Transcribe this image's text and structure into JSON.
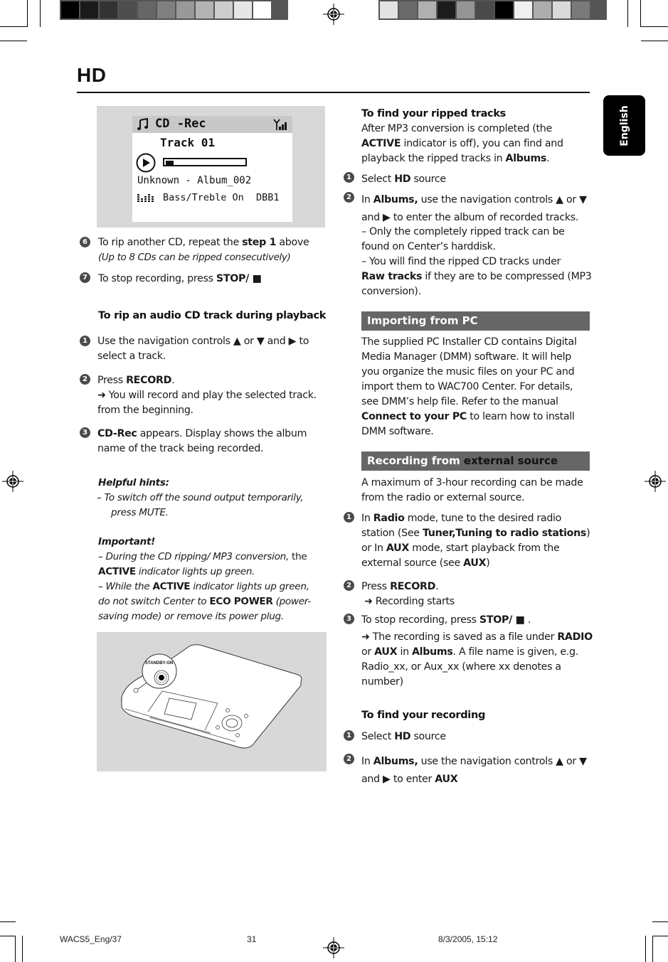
{
  "page": {
    "section_title": "HD",
    "language_tab": "English",
    "footer": {
      "file_ref": "WACS5_Eng/37",
      "page_number": "31",
      "date_time": "8/3/2005, 15:12"
    }
  },
  "calibration_bars": {
    "left": [
      "#000000",
      "#1a1a1a",
      "#333333",
      "#4d4d4d",
      "#666666",
      "#808080",
      "#999999",
      "#b3b3b3",
      "#cccccc",
      "#e6e6e6",
      "#ffffff"
    ],
    "right": [
      "#e3e3e3",
      "#6a6a6a",
      "#b0b0b0",
      "#1c1c1c",
      "#959595",
      "#4a4a4a",
      "#000000",
      "#f0f0f0",
      "#adadad",
      "#dadada",
      "#7a7a7a"
    ]
  },
  "lcd_display": {
    "mode": "CD -Rec",
    "track": "Track 01",
    "progress_fraction": 0.1,
    "album_line": "Unknown - Album_002",
    "eq_line": "Bass/Treble On",
    "dbb": "DBB1"
  },
  "device_illustration": {
    "button_label": "STANDBY-ON"
  },
  "left_column": {
    "steps_top": [
      {
        "number": "6",
        "text_pre": "To rip another CD, repeat the ",
        "bold": "step 1",
        "text_post": " above",
        "note": "(Up to 8 CDs can be ripped consecutively)"
      },
      {
        "number": "7",
        "text_pre": "To stop recording, press ",
        "bold": "STOP/ ■"
      }
    ],
    "playback_heading": "To rip an audio CD track during playback",
    "playback_steps": [
      {
        "number": "1",
        "line1": "Use the navigation controls ▲  or  ▼  and ▶ to",
        "line2": "select a track."
      },
      {
        "number": "2",
        "pre": "Press ",
        "bold": "RECORD",
        "post": ".",
        "result1": "➜ You will record and play the selected track.",
        "result2": "from the beginning."
      },
      {
        "number": "3",
        "bold": "CD-Rec",
        "post": " appears. Display shows the album",
        "line2": "name of the track being recorded."
      }
    ],
    "hints": {
      "heading": "Helpful hints:",
      "line1": "–  To switch off the sound output temporarily,",
      "line2": "press MUTE."
    },
    "important": {
      "heading": "Important!",
      "item1_pre": "–     During the CD ripping/ MP3 conversion,",
      "item1_post": " the",
      "item1_bold": "ACTIVE",
      "item1_rest": " indicator lights up green.",
      "item2_pre": "–   While the ",
      "item2_bold": "ACTIVE",
      "item2_post": " indicator lights up green,",
      "item2_line2_pre": "do not switch Center to ",
      "item2_line2_bold": "ECO POWER",
      "item2_line2_post": " (power-",
      "item2_line3": "saving mode) or remove its power plug."
    }
  },
  "right_column": {
    "find_ripped": {
      "heading": "To find your ripped tracks",
      "intro1": "After MP3 conversion is completed (the",
      "intro2_bold": "ACTIVE",
      "intro2_post": " indicator is off), you can find and",
      "intro3_pre": "playback the ripped tracks in ",
      "intro3_bold": "Albums",
      "intro3_post": ".",
      "steps": [
        {
          "number": "1",
          "pre": "Select ",
          "bold": "HD",
          "post": " source"
        },
        {
          "number": "2",
          "pre": "In ",
          "bold": "Albums,",
          "post": " use the navigation controls ▲  or  ▼",
          "line2": "and ▶ to enter the album of recorded tracks."
        }
      ],
      "note1a": "–  Only the completely ripped track can be",
      "note1b": "found on Center’s harddisk.",
      "note2a": "–   You will find the ripped CD tracks under",
      "note2b_bold": "Raw tracks",
      "note2b_post": " if they are to be compressed (MP3",
      "note2c": "conversion)."
    },
    "importing": {
      "bar_label": "Importing from PC",
      "lines": [
        "The supplied PC Installer CD contains Digital",
        "Media Manager (DMM) software.  It will help",
        "you organize the music files on your PC  and",
        "import them to WAC700 Center.  For details,",
        "see DMM’s help file. Refer to the manual"
      ],
      "line6_bold": "Connect to your PC",
      "line6_post": " to learn how to install",
      "line7": "DMM software."
    },
    "recording_external": {
      "bar_label_1": "Recording from ",
      "bar_label_2": "external source",
      "intro1": "A maximum of 3-hour recording can be made",
      "intro2": "from the radio or external source.",
      "step1": {
        "number": "1",
        "l1_pre": "In ",
        "l1_bold": "Radio",
        "l1_post": " mode, tune to the desired radio",
        "l2_pre": "station (See ",
        "l2_bold": "Tuner,Tuning to radio stations",
        "l2_post": ")",
        "l3_pre": "or In ",
        "l3_bold": "AUX",
        "l3_post": " mode, start playback from the",
        "l4_pre": "external source (see ",
        "l4_bold": "AUX",
        "l4_post": ")"
      },
      "step2": {
        "number": "2",
        "pre": "Press ",
        "bold": "RECORD",
        "post": ".",
        "result": "➜ Recording starts"
      },
      "step3": {
        "number": "3",
        "pre": "To stop recording,  press ",
        "bold": "STOP/ ■",
        "post": " .",
        "r1_pre": "➜ The recording is saved as a file under ",
        "r1_bold": "RADIO",
        "r2_pre": "or ",
        "r2_bold1": "AUX",
        "r2_mid": " in ",
        "r2_bold2": "Albums",
        "r2_post": ". A file name is given, e.g.",
        "r3": "Radio_xx, or  Aux_xx (where xx denotes a",
        "r4": "number)"
      }
    },
    "find_recording": {
      "heading": "To find your recording",
      "steps": [
        {
          "number": "1",
          "pre": "Select ",
          "bold": "HD",
          "post": " source"
        },
        {
          "number": "2",
          "pre": "In ",
          "bold": "Albums,",
          "post": " use the navigation controls ▲  or  ▼",
          "line2_pre": "and ▶ to enter ",
          "line2_bold": "AUX"
        }
      ]
    }
  }
}
